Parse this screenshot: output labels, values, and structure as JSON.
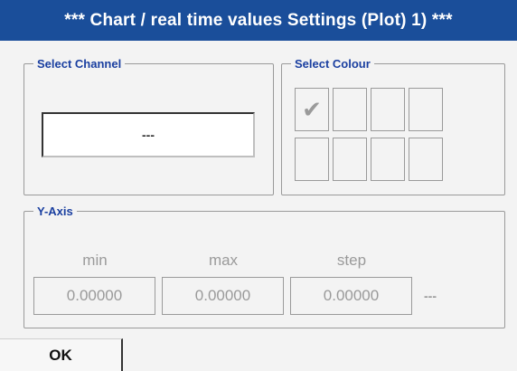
{
  "title": "***  Chart / real time values Settings (Plot) 1)  ***",
  "select_channel": {
    "legend": "Select Channel",
    "value": "---"
  },
  "select_colour": {
    "legend": "Select Colour",
    "swatches": [
      {
        "selected": true,
        "mark": "✔"
      },
      {
        "selected": false,
        "mark": ""
      },
      {
        "selected": false,
        "mark": ""
      },
      {
        "selected": false,
        "mark": ""
      },
      {
        "selected": false,
        "mark": ""
      },
      {
        "selected": false,
        "mark": ""
      },
      {
        "selected": false,
        "mark": ""
      },
      {
        "selected": false,
        "mark": ""
      }
    ]
  },
  "y_axis": {
    "legend": "Y-Axis",
    "min_label": "min",
    "max_label": "max",
    "step_label": "step",
    "min_value": "0.00000",
    "max_value": "0.00000",
    "step_value": "0.00000",
    "trailing": "---"
  },
  "ok_label": "OK",
  "colors": {
    "titlebar": "#1a4e9a",
    "legend_text": "#1a3fa0",
    "disabled_text": "#9a9a9a",
    "background": "#f3f3f3"
  }
}
